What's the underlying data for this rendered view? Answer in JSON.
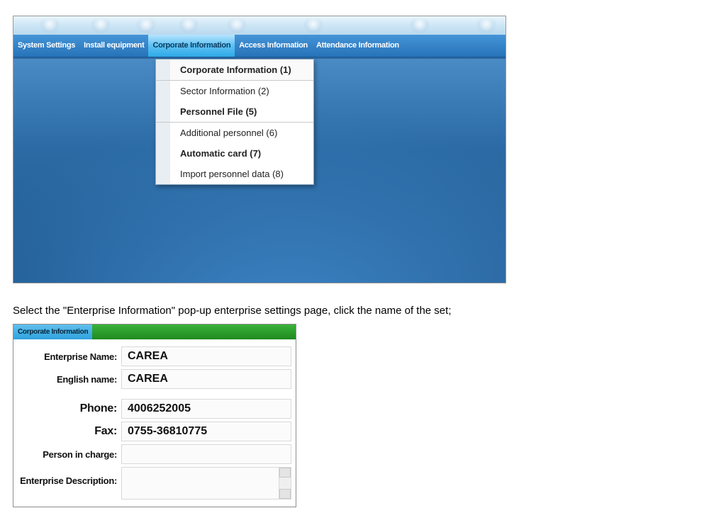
{
  "menubar": {
    "items": [
      {
        "label": "System Settings"
      },
      {
        "label": "Install equipment"
      },
      {
        "label": "Corporate Information",
        "active": true
      },
      {
        "label": "Access Information"
      },
      {
        "label": "Attendance Information"
      }
    ]
  },
  "dropdown": {
    "groups": [
      [
        {
          "label": "Corporate Information (1)",
          "bold": true
        }
      ],
      [
        {
          "label": "Sector Information (2)"
        },
        {
          "label": "Personnel File (5)",
          "bold": true
        }
      ],
      [
        {
          "label": "Additional personnel (6)"
        },
        {
          "label": "Automatic card (7)",
          "bold": true
        },
        {
          "label": "Import personnel data (8)"
        }
      ]
    ]
  },
  "caption": "Select the \"Enterprise Information\" pop-up enterprise settings page, click the name of the set;",
  "form": {
    "title": "Corporate Information",
    "fields": {
      "enterprise_name": {
        "label": "Enterprise Name:",
        "value": "CAREA"
      },
      "english_name": {
        "label": "English name:",
        "value": "CAREA"
      },
      "phone": {
        "label": "Phone:",
        "value": "4006252005"
      },
      "fax": {
        "label": "Fax:",
        "value": "0755-36810775"
      },
      "person_in_charge": {
        "label": "Person in charge:",
        "value": ""
      },
      "enterprise_description": {
        "label": "Enterprise Description:",
        "value": ""
      }
    }
  }
}
